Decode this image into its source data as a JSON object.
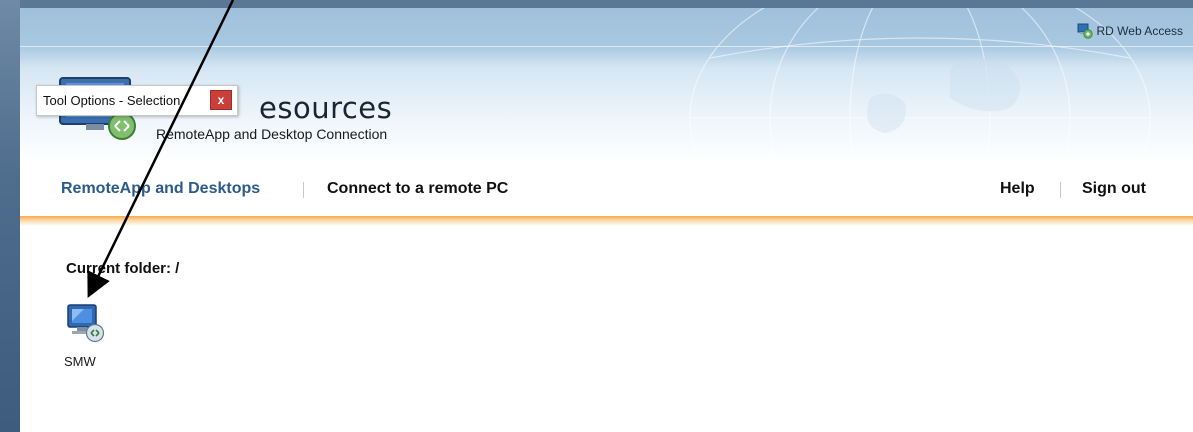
{
  "header": {
    "top_link": "RD Web Access",
    "title": "esources",
    "subtitle": "RemoteApp and Desktop Connection"
  },
  "tool_popup": {
    "title": "Tool Options - Selection",
    "close_glyph": "x"
  },
  "nav": {
    "remoteapp_label": "RemoteApp and Desktops",
    "connect_label": "Connect to a remote PC",
    "help_label": "Help",
    "signout_label": "Sign out"
  },
  "main": {
    "current_folder": "Current folder: /",
    "items": [
      {
        "label": "SMW",
        "icon": "remote-desktop-icon"
      }
    ]
  },
  "colors": {
    "nav_active": "#2c5a8a",
    "accent_orange": "#f7a845",
    "popup_close": "#c9403b"
  },
  "annotation": {
    "arrow_color": "#000000"
  }
}
